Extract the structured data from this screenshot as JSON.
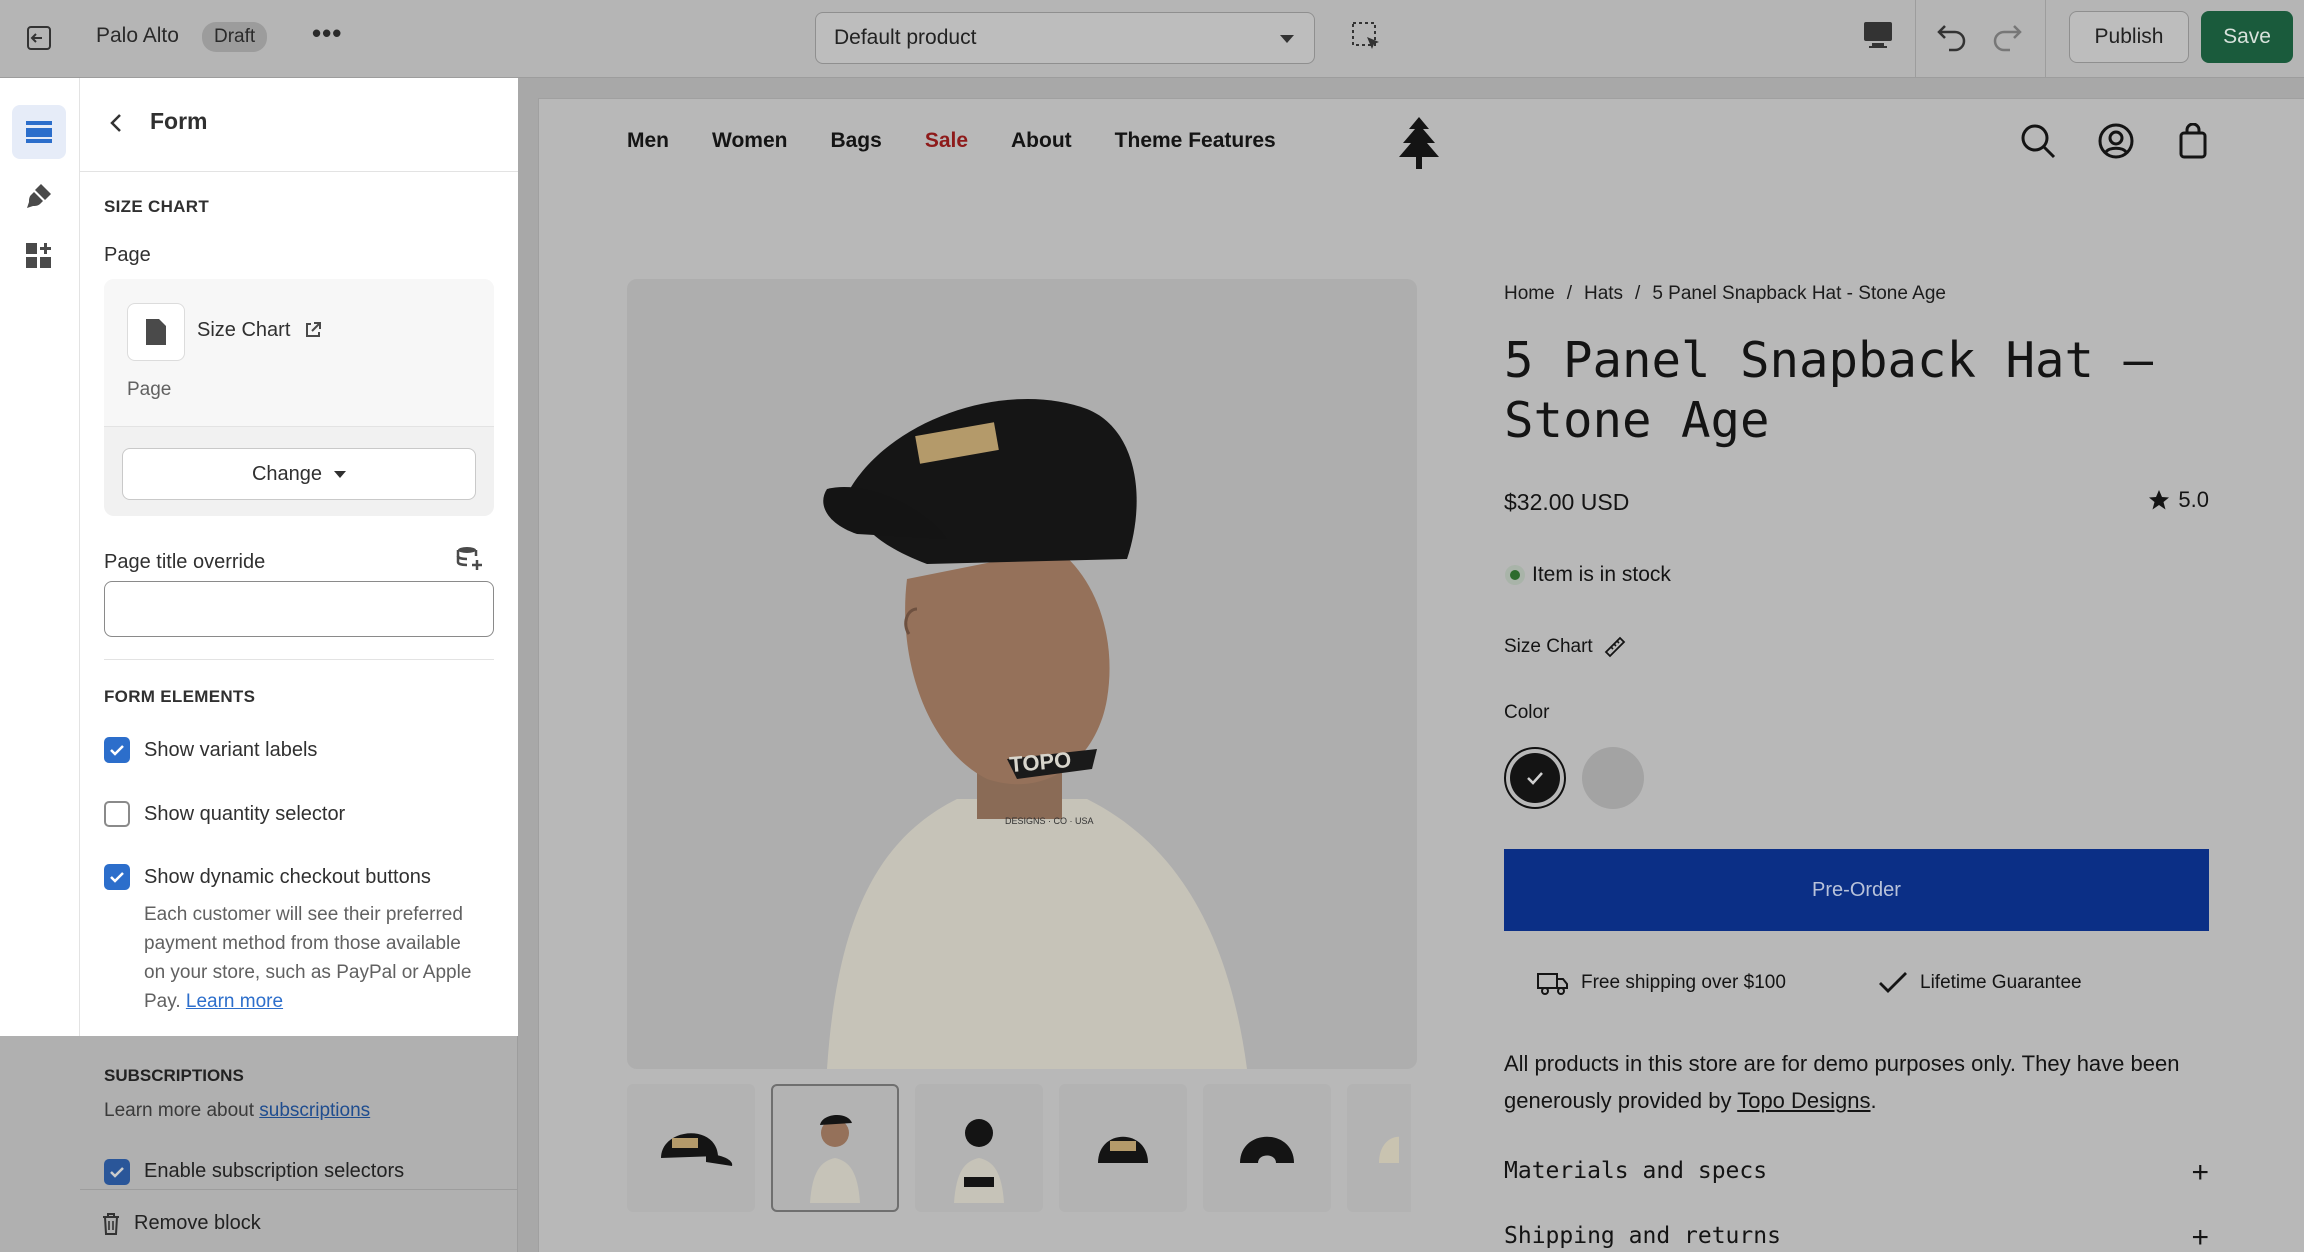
{
  "topbar": {
    "store_name": "Palo Alto",
    "status_badge": "Draft",
    "more_label": "•••",
    "template_select": "Default product",
    "publish_label": "Publish",
    "save_label": "Save"
  },
  "panel": {
    "title": "Form",
    "size_chart_heading": "SIZE CHART",
    "page_label": "Page",
    "page_name": "Size Chart",
    "page_type": "Page",
    "change_label": "Change",
    "title_override_label": "Page title override",
    "title_override_value": "",
    "form_elements_heading": "FORM ELEMENTS",
    "checkboxes": [
      {
        "label": "Show variant labels",
        "checked": true
      },
      {
        "label": "Show quantity selector",
        "checked": false
      },
      {
        "label": "Show dynamic checkout buttons",
        "checked": true
      }
    ],
    "help_text": "Each customer will see their preferred payment method from those available on your store, such as PayPal or Apple Pay.",
    "help_link": "Learn more",
    "subscriptions_heading": "SUBSCRIPTIONS",
    "subscriptions_text": "Learn more about",
    "subscriptions_link": "subscriptions",
    "enable_subscriptions_label": "Enable subscription selectors",
    "remove_label": "Remove block"
  },
  "store": {
    "nav": [
      "Men",
      "Women",
      "Bags",
      "Sale",
      "About",
      "Theme Features"
    ],
    "breadcrumb": [
      "Home",
      "/",
      "Hats",
      "/",
      "5 Panel Snapback Hat - Stone Age"
    ],
    "product_title": "5 Panel Snapback Hat – Stone Age",
    "price": "$32.00 USD",
    "rating": "5.0",
    "stock": "Item is in stock",
    "size_chart": "Size Chart",
    "color_label": "Color",
    "preorder_label": "Pre-Order",
    "shipping_perk": "Free shipping over $100",
    "guarantee_perk": "Lifetime Guarantee",
    "description": "All products in this store are for demo purposes only. They have been generously provided by",
    "description_link": "Topo Designs",
    "description_end": ".",
    "accordions": [
      "Materials and specs",
      "Shipping and returns"
    ],
    "brand_mark": "TOPO",
    "brand_tagline": "DESIGNS · CO · USA"
  },
  "colors": {
    "save_green": "#1a5b3c",
    "checkbox_blue": "#2c6ecb",
    "preorder_blue": "#0b2f86",
    "sale_red": "#8e1a1a"
  }
}
